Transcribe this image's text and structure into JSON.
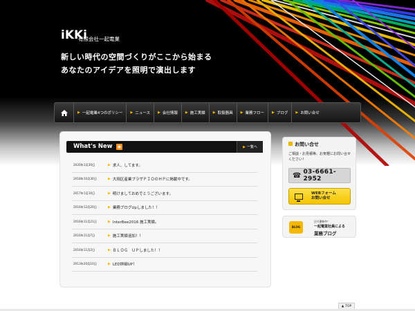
{
  "brand": {
    "logo": "iKKi",
    "company": "有限会社一起電業"
  },
  "hero": {
    "line1": "新しい時代の空間づくりがここから始まる",
    "line2": "あなたのアイデアを照明で演出します"
  },
  "nav": {
    "home_icon": "home-icon",
    "items": [
      {
        "label": "一起電業4つのポリシー"
      },
      {
        "label": "ニュース"
      },
      {
        "label": "会社情報"
      },
      {
        "label": "施工実績"
      },
      {
        "label": "取扱器具"
      },
      {
        "label": "業務フロー"
      },
      {
        "label": "ブログ"
      },
      {
        "label": "お問い合せ"
      }
    ]
  },
  "news": {
    "title": "What's New",
    "more": "一覧へ",
    "items": [
      {
        "date": "2020年1月30日",
        "text": "求人、してます。"
      },
      {
        "date": "2018年10月30日",
        "text": "大岡区産業プラザＰＩＯのＨＰに掲載中です。"
      },
      {
        "date": "2017年1月10日",
        "text": "明けましておめでとうございます。"
      },
      {
        "date": "2016年12月20日",
        "text": "業務ブログUpしました！！"
      },
      {
        "date": "2016年11月21日",
        "text": "InterBee2016 施工実績。"
      },
      {
        "date": "2016年11月7日",
        "text": "施工実績追加！！"
      },
      {
        "date": "2016年11月2日",
        "text": "ＢＬＯＧ　ＵＰしました！！"
      },
      {
        "date": "2013年20月10日",
        "text": "LED詳細UP！"
      }
    ]
  },
  "contact": {
    "title": "お問い合せ",
    "desc": "ご相談・お見積等、お気軽にお問い合せください！",
    "phone": "03-6661-2952",
    "web_line1": "WEBフォーム",
    "web_line2": "お問い合せ"
  },
  "blog": {
    "badge": "BLOG",
    "small": "日々更新中！",
    "line1": "一起電業社員による",
    "line2": "業務ブログ"
  },
  "top_link": "TOP",
  "colors": {
    "accent": "#f5b800",
    "header_bg": "#000000",
    "nav_bg": "#1e1e1e"
  }
}
